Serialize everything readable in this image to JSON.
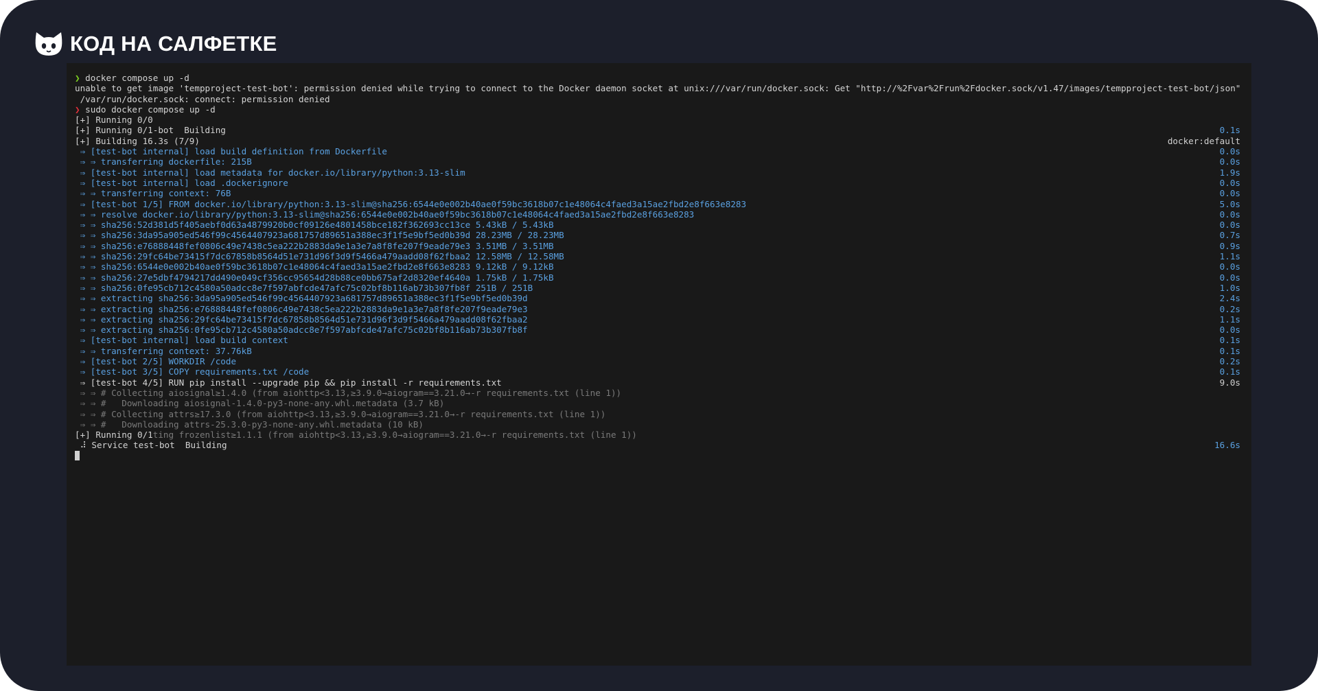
{
  "brand": {
    "name": "КОД НА САЛФЕТКЕ",
    "icon": "cat-icon"
  },
  "colors": {
    "frame": "#1c1f2b",
    "terminal": "#191919",
    "blue": "#5aa0e0",
    "green": "#7ed321",
    "red": "#e0303a",
    "dim": "#7a7a7a"
  },
  "terminal": {
    "lines": [
      {
        "prompt": "❯",
        "prompt_color": "green",
        "text": " docker compose up -d",
        "color": "white"
      },
      {
        "text": "unable to get image 'tempproject-test-bot': permission denied while trying to connect to the Docker daemon socket at unix:///var/run/docker.sock: Get \"http://%2Fvar%2Frun%2Fdocker.sock/v1.47/images/tempproject-test-bot/json\": dial unix",
        "color": "white"
      },
      {
        "text": " /var/run/docker.sock: connect: permission denied",
        "color": "white"
      },
      {
        "prompt": "❯",
        "prompt_color": "red",
        "text": " sudo docker compose up -d",
        "color": "white"
      },
      {
        "text": "[+] Running 0/0",
        "color": "white"
      },
      {
        "text": "[+] Running 0/1-bot  Building",
        "color": "white",
        "time": "0.1s"
      },
      {
        "text": "[+] Building 16.3s (7/9)",
        "color": "white",
        "time": "docker:default",
        "time_color": "white"
      },
      {
        "text": " ⇒ [test-bot internal] load build definition from Dockerfile",
        "color": "blue",
        "time": "0.0s"
      },
      {
        "text": " ⇒ ⇒ transferring dockerfile: 215B",
        "color": "blue",
        "time": "0.0s"
      },
      {
        "text": " ⇒ [test-bot internal] load metadata for docker.io/library/python:3.13-slim",
        "color": "blue",
        "time": "1.9s"
      },
      {
        "text": " ⇒ [test-bot internal] load .dockerignore",
        "color": "blue",
        "time": "0.0s"
      },
      {
        "text": " ⇒ ⇒ transferring context: 76B",
        "color": "blue",
        "time": "0.0s"
      },
      {
        "text": " ⇒ [test-bot 1/5] FROM docker.io/library/python:3.13-slim@sha256:6544e0e002b40ae0f59bc3618b07c1e48064c4faed3a15ae2fbd2e8f663e8283",
        "color": "blue",
        "time": "5.0s"
      },
      {
        "text": " ⇒ ⇒ resolve docker.io/library/python:3.13-slim@sha256:6544e0e002b40ae0f59bc3618b07c1e48064c4faed3a15ae2fbd2e8f663e8283",
        "color": "blue",
        "time": "0.0s"
      },
      {
        "text": " ⇒ ⇒ sha256:52d381d5f405aebf0d63a4879920b0cf09126e4801458bce182f362693cc13ce 5.43kB / 5.43kB",
        "color": "blue",
        "time": "0.0s"
      },
      {
        "text": " ⇒ ⇒ sha256:3da95a905ed546f99c4564407923a681757d89651a388ec3f1f5e9bf5ed0b39d 28.23MB / 28.23MB",
        "color": "blue",
        "time": "0.7s"
      },
      {
        "text": " ⇒ ⇒ sha256:e76888448fef0806c49e7438c5ea222b2883da9e1a3e7a8f8fe207f9eade79e3 3.51MB / 3.51MB",
        "color": "blue",
        "time": "0.9s"
      },
      {
        "text": " ⇒ ⇒ sha256:29fc64be73415f7dc67858b8564d51e731d96f3d9f5466a479aadd08f62fbaa2 12.58MB / 12.58MB",
        "color": "blue",
        "time": "1.1s"
      },
      {
        "text": " ⇒ ⇒ sha256:6544e0e002b40ae0f59bc3618b07c1e48064c4faed3a15ae2fbd2e8f663e8283 9.12kB / 9.12kB",
        "color": "blue",
        "time": "0.0s"
      },
      {
        "text": " ⇒ ⇒ sha256:27e5dbf4794217dd490e049cf356cc95654d28b88ce0bb675af2d8320ef4640a 1.75kB / 1.75kB",
        "color": "blue",
        "time": "0.0s"
      },
      {
        "text": " ⇒ ⇒ sha256:0fe95cb712c4580a50adcc8e7f597abfcde47afc75c02bf8b116ab73b307fb8f 251B / 251B",
        "color": "blue",
        "time": "1.0s"
      },
      {
        "text": " ⇒ ⇒ extracting sha256:3da95a905ed546f99c4564407923a681757d89651a388ec3f1f5e9bf5ed0b39d",
        "color": "blue",
        "time": "2.4s"
      },
      {
        "text": " ⇒ ⇒ extracting sha256:e76888448fef0806c49e7438c5ea222b2883da9e1a3e7a8f8fe207f9eade79e3",
        "color": "blue",
        "time": "0.2s"
      },
      {
        "text": " ⇒ ⇒ extracting sha256:29fc64be73415f7dc67858b8564d51e731d96f3d9f5466a479aadd08f62fbaa2",
        "color": "blue",
        "time": "1.1s"
      },
      {
        "text": " ⇒ ⇒ extracting sha256:0fe95cb712c4580a50adcc8e7f597abfcde47afc75c02bf8b116ab73b307fb8f",
        "color": "blue",
        "time": "0.0s"
      },
      {
        "text": " ⇒ [test-bot internal] load build context",
        "color": "blue",
        "time": "0.1s"
      },
      {
        "text": " ⇒ ⇒ transferring context: 37.76kB",
        "color": "blue",
        "time": "0.1s"
      },
      {
        "text": " ⇒ [test-bot 2/5] WORKDIR /code",
        "color": "blue",
        "time": "0.2s"
      },
      {
        "text": " ⇒ [test-bot 3/5] COPY requirements.txt /code",
        "color": "blue",
        "time": "0.1s"
      },
      {
        "text": " ⇒ [test-bot 4/5] RUN pip install --upgrade pip && pip install -r requirements.txt",
        "color": "white",
        "time": "9.0s",
        "time_color": "white"
      },
      {
        "text": " ⇒ ⇒ # Collecting aiosignal≥1.4.0 (from aiohttp<3.13,≥3.9.0→aiogram==3.21.0→-r requirements.txt (line 1))",
        "color": "dim"
      },
      {
        "text": " ⇒ ⇒ #   Downloading aiosignal-1.4.0-py3-none-any.whl.metadata (3.7 kB)",
        "color": "dim"
      },
      {
        "text": " ⇒ ⇒ # Collecting attrs≥17.3.0 (from aiohttp<3.13,≥3.9.0→aiogram==3.21.0→-r requirements.txt (line 1))",
        "color": "dim"
      },
      {
        "text": " ⇒ ⇒ #   Downloading attrs-25.3.0-py3-none-any.whl.metadata (10 kB)",
        "color": "dim"
      },
      {
        "text": "[+] Running 0/1",
        "color": "white",
        "overlay": "ting frozenlist≥1.1.1 (from aiohttp<3.13,≥3.9.0→aiogram==3.21.0→-r requirements.txt (line 1))"
      },
      {
        "text": " ⠼ Service test-bot  Building",
        "color": "white",
        "time": "16.6s"
      }
    ]
  }
}
